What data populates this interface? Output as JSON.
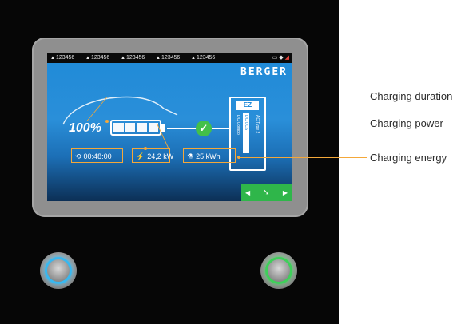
{
  "status_bar": {
    "items": [
      "123456",
      "123456",
      "123456",
      "123456",
      "123456"
    ],
    "system_icons": [
      "monitor-icon",
      "wifi-icon",
      "signal-icon"
    ]
  },
  "brand": {
    "name": "BERGER"
  },
  "vehicle": {
    "charge_percent": "100%",
    "battery_fill_fraction": 1.0
  },
  "connector": {
    "label": "EZ",
    "types": [
      "DC Combo",
      "DC CCS",
      "AC Type 2"
    ]
  },
  "info": {
    "duration": "00:48:00",
    "power": "24,2 kW",
    "energy": "25 kWh"
  },
  "callouts": {
    "duration": "Charging duration",
    "power": "Charging power",
    "energy": "Charging energy"
  },
  "colors": {
    "screen_blue": "#2a8fd9",
    "highlight_orange": "#f4a83a",
    "nav_green": "#2fb64a",
    "button_ring_blue": "#38b8f0",
    "button_ring_green": "#3ed05a"
  }
}
